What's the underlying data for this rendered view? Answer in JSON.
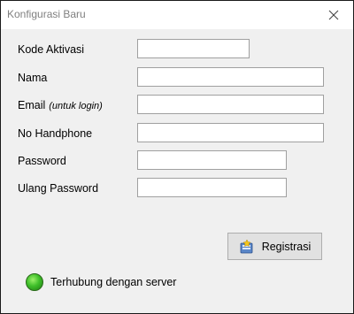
{
  "window": {
    "title": "Konfigurasi Baru"
  },
  "form": {
    "kode_aktivasi": {
      "label": "Kode Aktivasi",
      "value": ""
    },
    "nama": {
      "label": "Nama",
      "value": ""
    },
    "email": {
      "label": "Email",
      "hint": "(untuk login)",
      "value": ""
    },
    "no_handphone": {
      "label": "No Handphone",
      "value": ""
    },
    "password": {
      "label": "Password",
      "value": ""
    },
    "ulang_password": {
      "label": "Ulang Password",
      "value": ""
    }
  },
  "actions": {
    "register_label": "Registrasi",
    "register_icon": "register-icon"
  },
  "status": {
    "text": "Terhubung dengan server",
    "indicator_color": "#3fbf2a"
  }
}
